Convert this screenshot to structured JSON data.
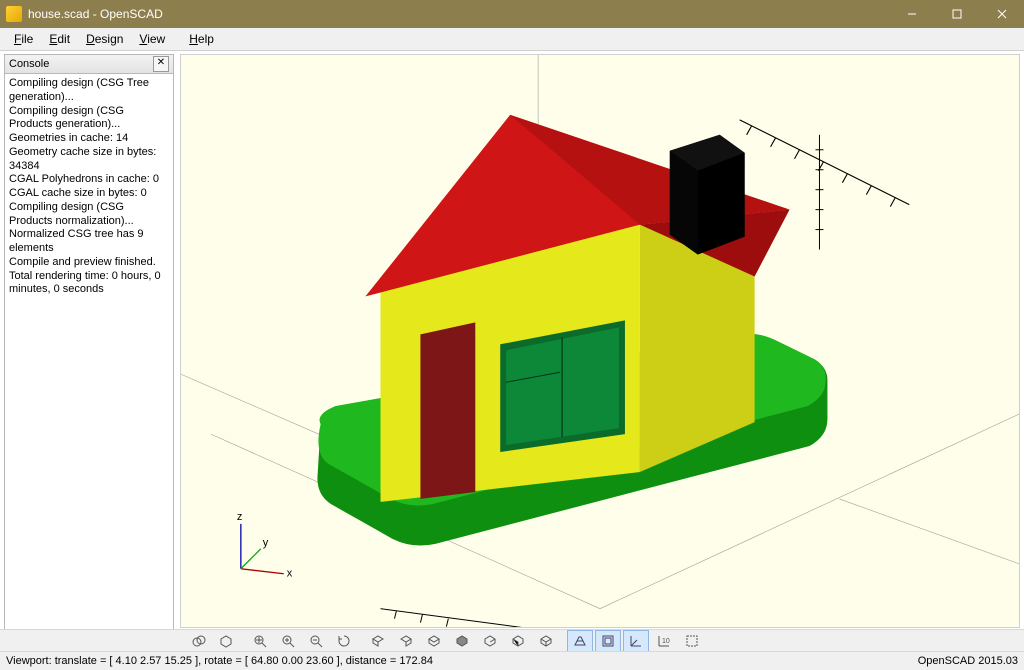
{
  "window": {
    "title": "house.scad - OpenSCAD"
  },
  "menu": {
    "file": "File",
    "edit": "Edit",
    "design": "Design",
    "view": "View",
    "help": "Help"
  },
  "console": {
    "title": "Console",
    "log": "Compiling design (CSG Tree generation)...\nCompiling design (CSG Products generation)...\nGeometries in cache: 14\nGeometry cache size in bytes: 34384\nCGAL Polyhedrons in cache: 0\nCGAL cache size in bytes: 0\nCompiling design (CSG Products normalization)...\nNormalized CSG tree has 9 elements\nCompile and preview finished.\nTotal rendering time: 0 hours, 0 minutes, 0 seconds"
  },
  "axes": {
    "x": "x",
    "y": "y",
    "z": "z"
  },
  "status": {
    "left": "Viewport: translate = [ 4.10 2.57 15.25 ], rotate = [ 64.80 0.00 23.60 ], distance = 172.84",
    "right": "OpenSCAD 2015.03"
  },
  "tools": {
    "preview": "preview",
    "render": "render",
    "view_all": "view-all",
    "zoom_in": "zoom-in",
    "zoom_out": "zoom-out",
    "reset": "reset-view",
    "right": "view-right",
    "top": "view-top",
    "bottom": "view-bottom",
    "left": "view-left",
    "front": "view-front",
    "back": "view-back",
    "diagonal": "view-diagonal",
    "persp": "perspective",
    "ortho": "orthogonal",
    "axes": "show-axes",
    "scale": "show-scale",
    "crosshair": "show-crosshair"
  }
}
